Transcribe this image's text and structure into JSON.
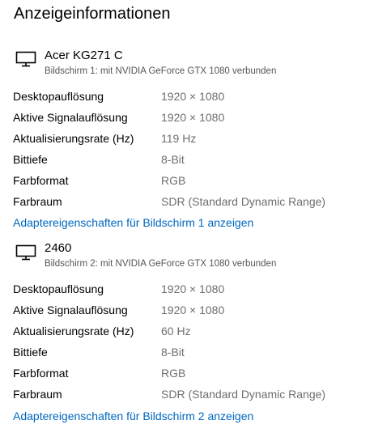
{
  "page": {
    "title": "Anzeigeinformationen"
  },
  "monitors": [
    {
      "icon": "monitor-icon",
      "name": "Acer KG271 C",
      "subtitle": "Bildschirm 1: mit NVIDIA GeForce GTX 1080 verbunden",
      "rows": [
        {
          "label": "Desktopauflösung",
          "value": "1920 × 1080"
        },
        {
          "label": "Aktive Signalauflösung",
          "value": "1920 × 1080"
        },
        {
          "label": "Aktualisierungsrate (Hz)",
          "value": "119 Hz"
        },
        {
          "label": "Bittiefe",
          "value": "8-Bit"
        },
        {
          "label": "Farbformat",
          "value": "RGB"
        },
        {
          "label": "Farbraum",
          "value": "SDR (Standard Dynamic Range)"
        }
      ],
      "link": "Adaptereigenschaften für Bildschirm 1 anzeigen"
    },
    {
      "icon": "monitor-icon",
      "name": "2460",
      "subtitle": "Bildschirm 2: mit NVIDIA GeForce GTX 1080 verbunden",
      "rows": [
        {
          "label": "Desktopauflösung",
          "value": "1920 × 1080"
        },
        {
          "label": "Aktive Signalauflösung",
          "value": "1920 × 1080"
        },
        {
          "label": "Aktualisierungsrate (Hz)",
          "value": "60 Hz"
        },
        {
          "label": "Bittiefe",
          "value": "8-Bit"
        },
        {
          "label": "Farbformat",
          "value": "RGB"
        },
        {
          "label": "Farbraum",
          "value": "SDR (Standard Dynamic Range)"
        }
      ],
      "link": "Adaptereigenschaften für Bildschirm 2 anzeigen"
    }
  ],
  "colors": {
    "link": "#0067c0",
    "value_text": "#6e6e6e",
    "subtitle_text": "#555555"
  }
}
